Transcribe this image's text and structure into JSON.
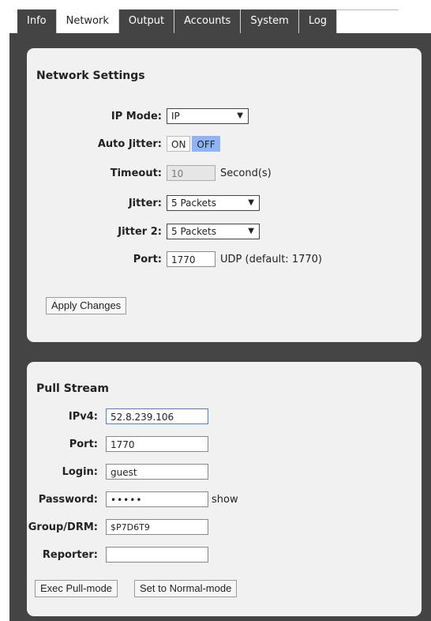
{
  "tabs": [
    {
      "label": "Info"
    },
    {
      "label": "Network"
    },
    {
      "label": "Output"
    },
    {
      "label": "Accounts"
    },
    {
      "label": "System"
    },
    {
      "label": "Log"
    }
  ],
  "active_tab": "Network",
  "network": {
    "title": "Network Settings",
    "ip_mode": {
      "label": "IP Mode:",
      "value": "IP"
    },
    "auto_jitter": {
      "label": "Auto Jitter:",
      "on": "ON",
      "off": "OFF",
      "selected": "OFF"
    },
    "timeout": {
      "label": "Timeout:",
      "value": "10",
      "suffix": "Second(s)"
    },
    "jitter": {
      "label": "Jitter:",
      "value": "5 Packets"
    },
    "jitter2": {
      "label": "Jitter 2:",
      "value": "5 Packets"
    },
    "port": {
      "label": "Port:",
      "value": "1770",
      "suffix": "UDP (default: 1770)"
    },
    "apply": "Apply Changes"
  },
  "pull": {
    "title": "Pull Stream",
    "ipv4": {
      "label": "IPv4:",
      "value": "52.8.239.106"
    },
    "port": {
      "label": "Port:",
      "value": "1770"
    },
    "login": {
      "label": "Login:",
      "value": "guest"
    },
    "password": {
      "label": "Password:",
      "value": "•••••",
      "show": "show"
    },
    "group": {
      "label": "Group/DRM:",
      "value": "$P7D6T9"
    },
    "reporter": {
      "label": "Reporter:",
      "value": ""
    },
    "exec": "Exec Pull-mode",
    "normal": "Set to Normal-mode"
  },
  "colors": {
    "frame": "#444444",
    "panel": "#f1f1f1",
    "toggle_selected": "#8fb4f5",
    "focus_border": "#4a7fd6"
  },
  "icons": {
    "dropdown": "triangle-down-icon"
  }
}
